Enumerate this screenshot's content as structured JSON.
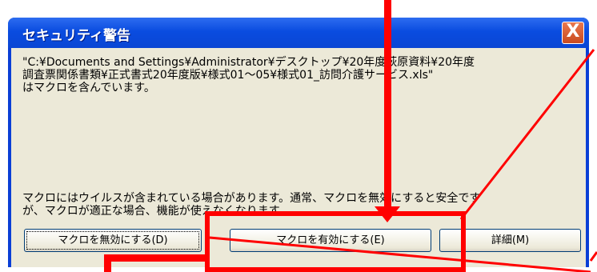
{
  "dialog": {
    "title": "セキュリティ警告",
    "close_label": "X",
    "message_lines": [
      "\"C:¥Documents and Settings¥Administrator¥デスクトップ¥20年度萩原資料¥20年度",
      "調査票関係書類¥正式書式20年度版¥様式01～05¥様式01_訪問介護サービス.xls\"",
      "はマクロを含んでいます。"
    ],
    "warning_lines": [
      "マクロにはウイルスが含まれている場合があります。通常、マクロを無効にすると安全です",
      "が、マクロが適正な場合、機能が使えなくなります。"
    ],
    "buttons": {
      "disable": "マクロを無効にする(D)",
      "enable": "マクロを有効にする(E)",
      "details": "詳細(M)"
    }
  },
  "colors": {
    "annotation": "#ff0000",
    "titlebar": "#0a4ce0",
    "client": "#ece9d8"
  }
}
